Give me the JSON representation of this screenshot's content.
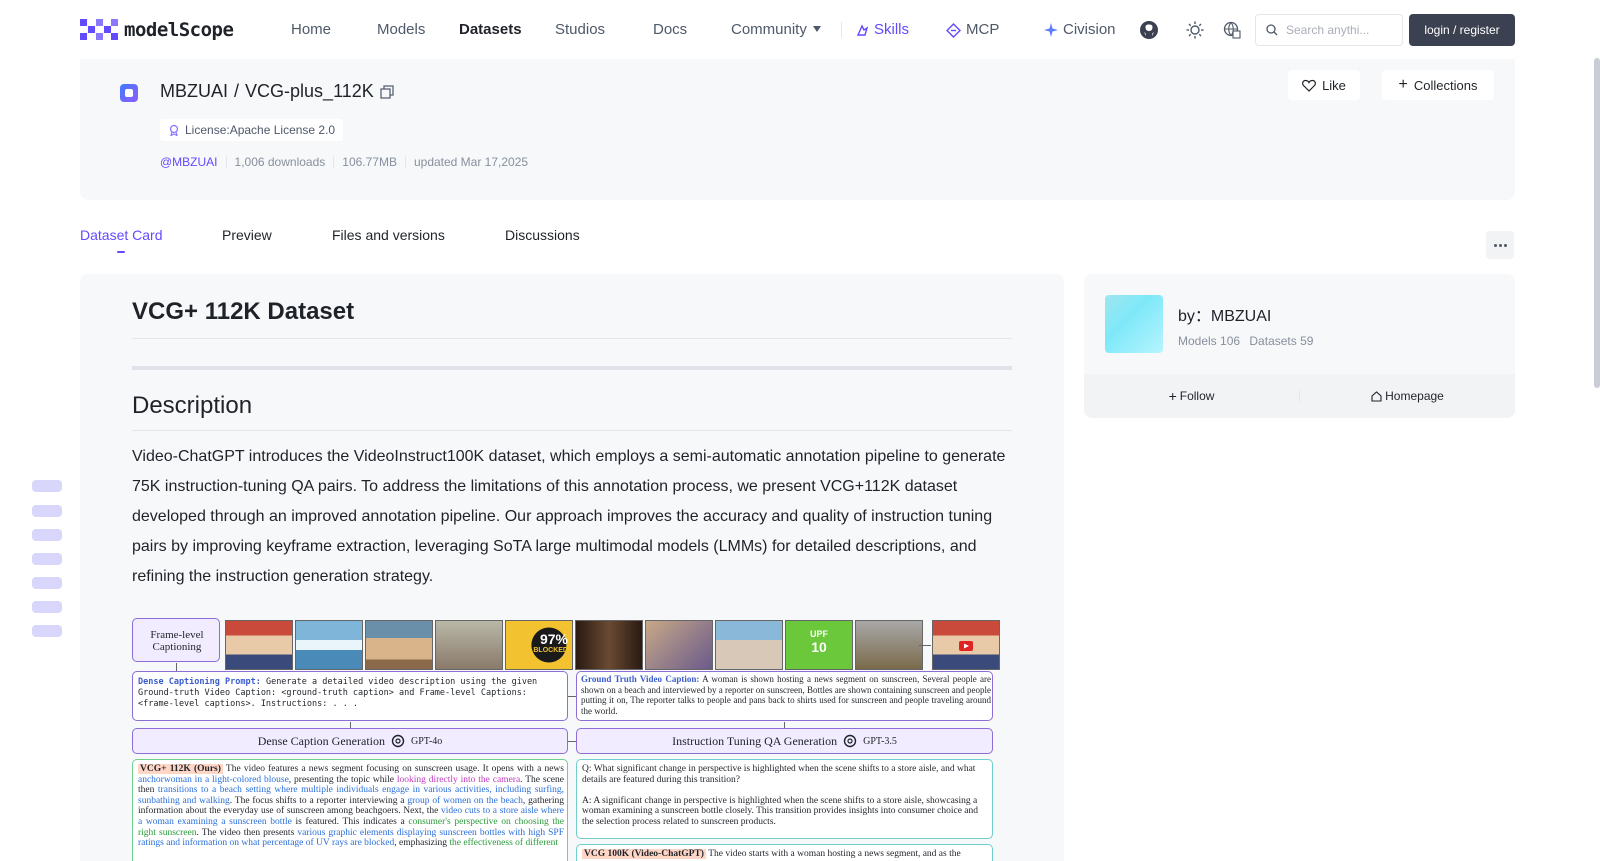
{
  "header": {
    "logo_text": "modelScope",
    "nav": [
      {
        "label": "Home"
      },
      {
        "label": "Models"
      },
      {
        "label": "Datasets"
      },
      {
        "label": "Studios"
      },
      {
        "label": "Docs"
      },
      {
        "label": "Community"
      },
      {
        "label": "Skills"
      },
      {
        "label": "MCP"
      },
      {
        "label": "Civision"
      }
    ],
    "search_placeholder": "Search anythi...",
    "login_label": "login / register",
    "icons": [
      "github-icon",
      "theme-toggle-icon",
      "language-icon",
      "search-icon"
    ],
    "accent_color": "#624aff"
  },
  "repo": {
    "owner": "MBZUAI",
    "separator": "/",
    "name": "VCG-plus_112K",
    "license": "License:Apache License 2.0",
    "owner_link": "@MBZUAI",
    "downloads": "1,006 downloads",
    "size": "106.77MB",
    "updated": "updated Mar 17,2025",
    "like_label": "Like",
    "collections_label": "Collections"
  },
  "tabs": [
    {
      "label": "Dataset Card",
      "active": true
    },
    {
      "label": "Preview"
    },
    {
      "label": "Files and versions"
    },
    {
      "label": "Discussions"
    }
  ],
  "readme": {
    "title": " VCG+ 112K Dataset",
    "section_title": " Description",
    "description": "Video-ChatGPT introduces the VideoInstruct100K dataset, which employs a semi-automatic annotation pipeline to generate 75K instruction-tuning QA pairs. To address the limitations of this annotation process, we present VCG+112K dataset developed through an improved annotation pipeline. Our approach improves the accuracy and quality of instruction tuning pairs by improving keyframe extraction, leveraging SoTA large multimodal models (LMMs) for detailed descriptions, and refining the instruction generation strategy.",
    "figure": {
      "frame_label_1": "Frame-level",
      "frame_label_2": "Captioning",
      "frame_text_1": "97%",
      "frame_text_2": "BLOCKED",
      "frame_text_3": "UPF",
      "frame_text_4": "10",
      "dense_prompt_title": "Dense Captioning Prompt:",
      "dense_prompt_body": "Generate a detailed video description using the given Ground-truth Video Caption: <ground-truth caption> and Frame-level Captions: <frame-level captions>. Instructions: . . .",
      "gt_title": "Ground Truth Video Caption:",
      "gt_body": "A woman is shown hosting a news segment on sunscreen, Several people are shown on a beach and interviewed by a reporter on sunscreen, Bottles are shown containing sunscreen and people putting it on, The reporter talks to people and pans back to shirts used for sunscreen and people traveling around the world.",
      "dense_gen_label": "Dense Caption Generation",
      "dense_gen_model": "GPT-4o",
      "qa_gen_label": "Instruction Tuning QA Generation",
      "qa_gen_model": "GPT-3.5",
      "vcg_tag": "VCG+ 112K (Ours)",
      "vcg_s1": "The video features a news segment focusing on sunscreen usage. It opens with a news ",
      "vcg_s2": "anchorwoman in a light-colored blouse",
      "vcg_s3": ", presenting the topic while ",
      "vcg_s4": "looking directly into the camera",
      "vcg_s5": ". The scene then ",
      "vcg_s6": "transitions to a beach setting where multiple individuals engage in various activities, including surfing, sunbathing and walking",
      "vcg_s7": ". The focus shifts to a reporter interviewing a ",
      "vcg_s8": "group of women on the beach",
      "vcg_s9": ", gathering information about the everyday use of sunscreen among beachgoers. Next, the ",
      "vcg_s10": "video cuts to a store aisle where a woman examining a sunscreen bottle",
      "vcg_s11": " is featured. This indicates a ",
      "vcg_s12": "consumer's perspective on choosing the right sunscreen",
      "vcg_s13": ". The video then presents ",
      "vcg_s14": "various graphic elements displaying sunscreen bottles with high SPF ratings and information on what percentage of UV rays are blocked",
      "vcg_s15": ", emphasizing ",
      "vcg_s16": "the effectiveness of different",
      "q_text": "Q: What significant change in perspective is highlighted when the scene shifts to a store aisle, and what details are featured during this transition?",
      "a_text": "A: A significant change in perspective is highlighted when the scene shifts to a store aisle, showcasing a woman examining a sunscreen bottle closely. This transition provides insights into consumer choice and the selection process related to sunscreen products.",
      "vcg100_tag": "VCG 100K (Video-ChatGPT)",
      "vcg100_body": "The video starts with a woman hosting a news segment, and as the"
    }
  },
  "sidebar": {
    "by_label": "by：MBZUAI",
    "models": "Models 106",
    "datasets": "Datasets 59",
    "follow_label": "Follow",
    "homepage_label": "Homepage"
  }
}
